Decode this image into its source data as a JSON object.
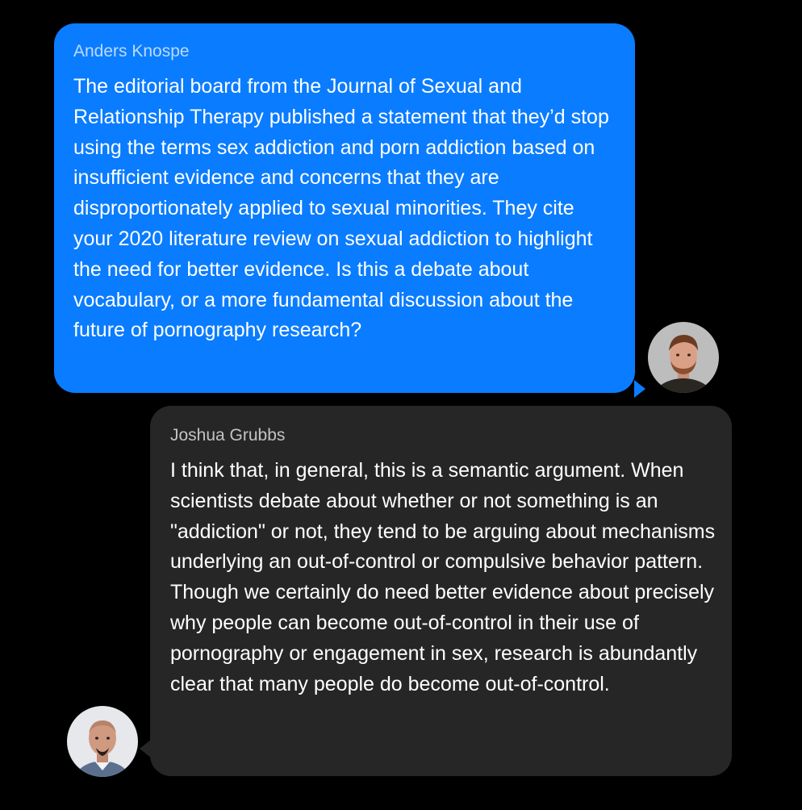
{
  "messages": [
    {
      "sender": "Anders Knospe",
      "text": "The editorial board from the Journal of Sexual and Relationship Therapy published a statement that they’d stop using the terms sex addiction and porn addiction based on insufficient evidence and concerns that they are disproportionately applied to sexual minorities. They cite your 2020 literature review on sexual addiction to highlight the need for better evidence. Is this a debate about vocabulary, or a more fundamental discussion about the future of pornography research?"
    },
    {
      "sender": "Joshua Grubbs",
      "text": "I think that, in general, this is a semantic argument. When scientists debate about whether or not something is an \"addiction\" or not, they tend to be arguing about mechanisms underlying an out-of-control or compulsive behavior pattern. Though we certainly do need better evidence about precisely why people can become out-of-control in their use of pornography or engagement in sex, research is abundantly clear that many people do become out-of-control."
    }
  ],
  "colors": {
    "background": "#000000",
    "outgoing_bubble": "#0a7cff",
    "incoming_bubble": "#262626",
    "text": "#ffffff"
  }
}
